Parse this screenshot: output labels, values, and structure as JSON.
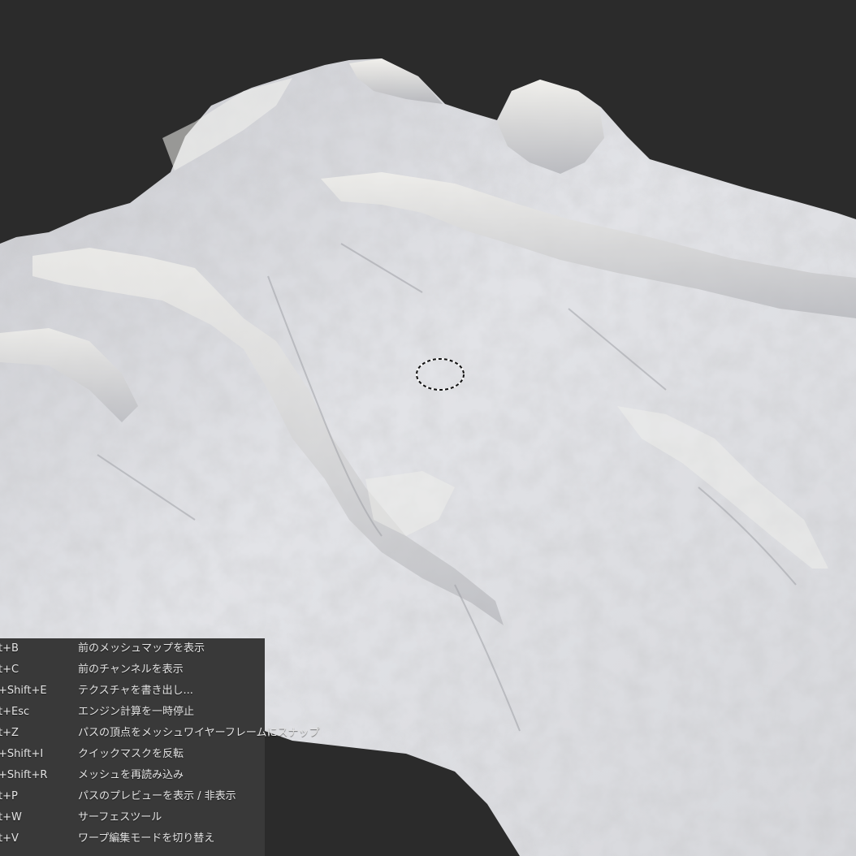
{
  "viewport": {
    "background_color": "#2b2b2b",
    "terrain_color": "#dcdde1",
    "brush_cursor_icon": "dashed-circle-brush-cursor"
  },
  "shortcuts": [
    {
      "key": "t+B",
      "action": "前のメッシュマップを表示"
    },
    {
      "key": "t+C",
      "action": "前のチャンネルを表示"
    },
    {
      "key": "+Shift+E",
      "action": "テクスチャを書き出し..."
    },
    {
      "key": "t+Esc",
      "action": "エンジン計算を一時停止"
    },
    {
      "key": "t+Z",
      "action": "パスの頂点をメッシュワイヤーフレームにスナップ"
    },
    {
      "key": "+Shift+I",
      "action": "クイックマスクを反転"
    },
    {
      "key": "+Shift+R",
      "action": "メッシュを再読み込み"
    },
    {
      "key": "t+P",
      "action": "パスのプレビューを表示 / 非表示"
    },
    {
      "key": "t+W",
      "action": "サーフェスツール"
    },
    {
      "key": "t+V",
      "action": "ワープ編集モードを切り替え"
    }
  ]
}
